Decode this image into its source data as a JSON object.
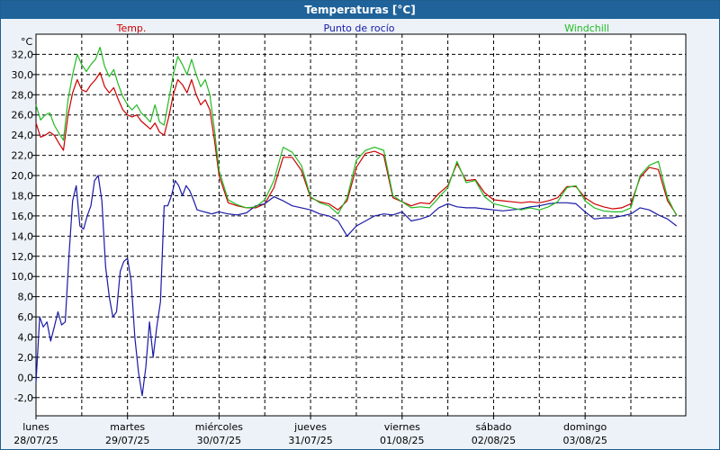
{
  "window": {
    "title": "Temperaturas [°C]"
  },
  "chart_data": {
    "type": "line",
    "title": "Temperaturas [°C]",
    "ylabel": "°C",
    "ylim": [
      -3.8,
      34.0
    ],
    "yticks": [
      32.0,
      30.0,
      28.0,
      26.0,
      24.0,
      22.0,
      20.0,
      18.0,
      16.0,
      14.0,
      12.0,
      10.0,
      8.0,
      6.0,
      4.0,
      2.0,
      0.0,
      -2.0
    ],
    "ytick_labels": [
      "32,0",
      "30,0",
      "28,0",
      "26,0",
      "24,0",
      "22,0",
      "20,0",
      "18,0",
      "16,0",
      "14,0",
      "12,0",
      "10,0",
      "8,0",
      "6,0",
      "4,0",
      "2,0",
      "0,0",
      "-2,0"
    ],
    "xlim": [
      0,
      7.1
    ],
    "grid": true,
    "day_labels": [
      {
        "x": 0,
        "weekday": "lunes",
        "date": "28/07/25"
      },
      {
        "x": 1,
        "weekday": "martes",
        "date": "29/07/25"
      },
      {
        "x": 2,
        "weekday": "miércoles",
        "date": "30/07/25"
      },
      {
        "x": 3,
        "weekday": "jueves",
        "date": "31/07/25"
      },
      {
        "x": 4,
        "weekday": "viernes",
        "date": "01/08/25"
      },
      {
        "x": 5,
        "weekday": "sábado",
        "date": "02/08/25"
      },
      {
        "x": 6,
        "weekday": "domingo",
        "date": "03/08/25"
      }
    ],
    "series": [
      {
        "name": "Temp.",
        "color": "#cc0000",
        "x": [
          0,
          0.05,
          0.1,
          0.15,
          0.2,
          0.25,
          0.3,
          0.35,
          0.4,
          0.45,
          0.5,
          0.55,
          0.6,
          0.65,
          0.7,
          0.75,
          0.8,
          0.85,
          0.9,
          0.95,
          1.0,
          1.05,
          1.1,
          1.15,
          1.2,
          1.25,
          1.3,
          1.35,
          1.4,
          1.45,
          1.5,
          1.55,
          1.6,
          1.65,
          1.7,
          1.75,
          1.8,
          1.85,
          1.9,
          1.95,
          2.0,
          2.1,
          2.2,
          2.3,
          2.4,
          2.5,
          2.6,
          2.7,
          2.8,
          2.9,
          3.0,
          3.1,
          3.2,
          3.3,
          3.4,
          3.5,
          3.6,
          3.7,
          3.8,
          3.9,
          4.0,
          4.1,
          4.2,
          4.3,
          4.4,
          4.5,
          4.6,
          4.7,
          4.8,
          4.9,
          5.0,
          5.1,
          5.2,
          5.3,
          5.4,
          5.5,
          5.6,
          5.7,
          5.8,
          5.9,
          6.0,
          6.1,
          6.2,
          6.3,
          6.4,
          6.5,
          6.6,
          6.7,
          6.8,
          6.9,
          7.0
        ],
        "y": [
          25.2,
          23.8,
          24.0,
          24.3,
          24.0,
          23.2,
          22.5,
          26.0,
          28.2,
          29.5,
          28.5,
          28.3,
          29.0,
          29.5,
          30.2,
          28.8,
          28.2,
          28.7,
          27.5,
          26.5,
          26.0,
          25.8,
          26.0,
          25.4,
          25.0,
          24.6,
          25.2,
          24.3,
          24.0,
          25.8,
          28.0,
          29.5,
          29.0,
          28.2,
          29.5,
          28.0,
          27.0,
          27.5,
          26.5,
          23.5,
          20.0,
          17.3,
          17.0,
          16.8,
          16.8,
          17.2,
          18.8,
          21.8,
          21.8,
          20.5,
          17.8,
          17.4,
          17.2,
          16.6,
          17.5,
          20.8,
          22.2,
          22.4,
          22.0,
          17.8,
          17.4,
          17.0,
          17.3,
          17.2,
          18.2,
          19.0,
          21.2,
          19.5,
          19.6,
          18.3,
          17.6,
          17.5,
          17.4,
          17.3,
          17.4,
          17.3,
          17.5,
          17.8,
          18.9,
          18.9,
          17.8,
          17.2,
          16.9,
          16.7,
          16.8,
          17.2,
          19.8,
          20.8,
          20.6,
          17.5,
          16.1
        ]
      },
      {
        "name": "Punto de rocío",
        "color": "#1a1aa6",
        "x": [
          0,
          0.04,
          0.08,
          0.12,
          0.16,
          0.2,
          0.24,
          0.28,
          0.32,
          0.36,
          0.4,
          0.44,
          0.48,
          0.52,
          0.56,
          0.6,
          0.64,
          0.68,
          0.72,
          0.76,
          0.8,
          0.84,
          0.88,
          0.92,
          0.96,
          1.0,
          1.04,
          1.08,
          1.12,
          1.16,
          1.2,
          1.24,
          1.28,
          1.32,
          1.36,
          1.4,
          1.44,
          1.48,
          1.52,
          1.56,
          1.6,
          1.64,
          1.68,
          1.72,
          1.76,
          1.8,
          1.84,
          1.88,
          1.92,
          1.96,
          2.0,
          2.1,
          2.2,
          2.3,
          2.4,
          2.5,
          2.6,
          2.7,
          2.8,
          2.9,
          3.0,
          3.1,
          3.2,
          3.3,
          3.4,
          3.5,
          3.6,
          3.7,
          3.8,
          3.9,
          4.0,
          4.1,
          4.2,
          4.3,
          4.4,
          4.5,
          4.6,
          4.7,
          4.8,
          4.9,
          5.0,
          5.1,
          5.2,
          5.3,
          5.4,
          5.5,
          5.6,
          5.7,
          5.8,
          5.9,
          6.0,
          6.1,
          6.2,
          6.3,
          6.4,
          6.5,
          6.6,
          6.7,
          6.8,
          6.9,
          7.0
        ],
        "y": [
          -0.5,
          6.0,
          5.0,
          5.5,
          3.6,
          5.0,
          6.5,
          5.2,
          5.5,
          12.0,
          17.5,
          19.0,
          15.0,
          14.7,
          16.0,
          17.0,
          19.5,
          20.0,
          17.5,
          11.0,
          8.0,
          6.0,
          6.5,
          10.5,
          11.5,
          11.8,
          9.5,
          4.0,
          0.5,
          -1.8,
          1.0,
          5.5,
          2.0,
          5.0,
          7.5,
          17.0,
          17.0,
          18.0,
          19.5,
          19.0,
          18.0,
          19.0,
          18.5,
          17.6,
          16.6,
          16.5,
          16.4,
          16.3,
          16.2,
          16.3,
          16.4,
          16.2,
          16.1,
          16.3,
          17.0,
          17.2,
          17.9,
          17.5,
          17.0,
          16.8,
          16.6,
          16.2,
          16.0,
          15.5,
          14.0,
          15.0,
          15.5,
          16.0,
          16.2,
          16.1,
          16.4,
          15.5,
          15.7,
          16.0,
          16.8,
          17.2,
          16.9,
          16.8,
          16.8,
          16.7,
          16.6,
          16.5,
          16.6,
          16.7,
          16.9,
          17.0,
          17.2,
          17.3,
          17.3,
          17.2,
          16.4,
          15.7,
          15.8,
          15.8,
          16.0,
          16.2,
          16.8,
          16.6,
          16.1,
          15.7,
          15.0
        ]
      },
      {
        "name": "Windchill",
        "color": "#22bb22",
        "x": [
          0,
          0.05,
          0.1,
          0.15,
          0.2,
          0.25,
          0.3,
          0.35,
          0.4,
          0.45,
          0.5,
          0.55,
          0.6,
          0.65,
          0.7,
          0.75,
          0.8,
          0.85,
          0.9,
          0.95,
          1.0,
          1.05,
          1.1,
          1.15,
          1.2,
          1.25,
          1.3,
          1.35,
          1.4,
          1.45,
          1.5,
          1.55,
          1.6,
          1.65,
          1.7,
          1.75,
          1.8,
          1.85,
          1.9,
          1.95,
          2.0,
          2.1,
          2.2,
          2.3,
          2.4,
          2.5,
          2.6,
          2.7,
          2.8,
          2.9,
          3.0,
          3.1,
          3.2,
          3.3,
          3.4,
          3.5,
          3.6,
          3.7,
          3.8,
          3.9,
          4.0,
          4.1,
          4.2,
          4.3,
          4.4,
          4.5,
          4.6,
          4.7,
          4.8,
          4.9,
          5.0,
          5.1,
          5.2,
          5.3,
          5.4,
          5.5,
          5.6,
          5.7,
          5.8,
          5.9,
          6.0,
          6.1,
          6.2,
          6.3,
          6.4,
          6.5,
          6.6,
          6.7,
          6.8,
          6.9,
          7.0
        ],
        "y": [
          27.0,
          25.5,
          26.0,
          26.2,
          25.0,
          24.2,
          23.5,
          27.5,
          30.0,
          32.0,
          31.0,
          30.3,
          31.0,
          31.5,
          32.7,
          30.8,
          29.8,
          30.5,
          29.0,
          27.8,
          27.0,
          26.5,
          27.0,
          26.2,
          25.8,
          25.3,
          27.0,
          25.3,
          25.0,
          27.5,
          30.0,
          31.8,
          31.0,
          30.0,
          31.5,
          30.0,
          28.8,
          29.5,
          28.0,
          24.5,
          20.5,
          17.6,
          17.1,
          16.8,
          16.9,
          17.6,
          19.5,
          22.8,
          22.3,
          21.0,
          17.9,
          17.3,
          17.0,
          16.2,
          17.8,
          21.5,
          22.5,
          22.8,
          22.5,
          18.0,
          17.4,
          16.8,
          16.9,
          16.8,
          17.8,
          18.8,
          21.4,
          19.3,
          19.5,
          17.9,
          17.2,
          17.0,
          16.8,
          16.6,
          16.8,
          16.6,
          16.9,
          17.4,
          18.8,
          19.0,
          17.5,
          16.8,
          16.5,
          16.4,
          16.4,
          16.8,
          20.0,
          21.0,
          21.4,
          17.8,
          16.0
        ]
      }
    ]
  }
}
